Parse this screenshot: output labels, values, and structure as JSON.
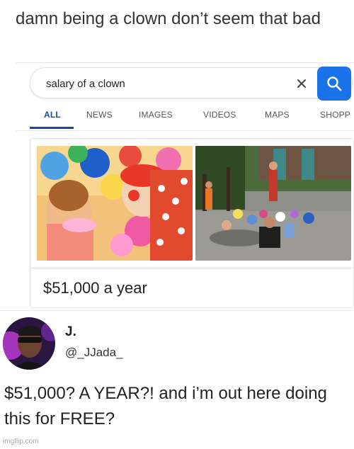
{
  "caption": "damn being a clown don’t seem that bad",
  "search": {
    "query": "salary of a clown",
    "clear_icon": "close-icon",
    "search_icon": "search-icon",
    "accent_color": "#1a73e8"
  },
  "tabs": [
    {
      "label": "ALL",
      "active": true
    },
    {
      "label": "NEWS",
      "active": false
    },
    {
      "label": "IMAGES",
      "active": false
    },
    {
      "label": "VIDEOS",
      "active": false
    },
    {
      "label": "MAPS",
      "active": false
    },
    {
      "label": "SHOPP",
      "active": false
    }
  ],
  "result": {
    "answer": "$51,000 a year"
  },
  "tweet": {
    "display_name": "J.",
    "handle": "@_JJada_",
    "text": "$51,000? A YEAR?! and i’m out here doing this for FREE?"
  },
  "watermark": "imgflip.com"
}
